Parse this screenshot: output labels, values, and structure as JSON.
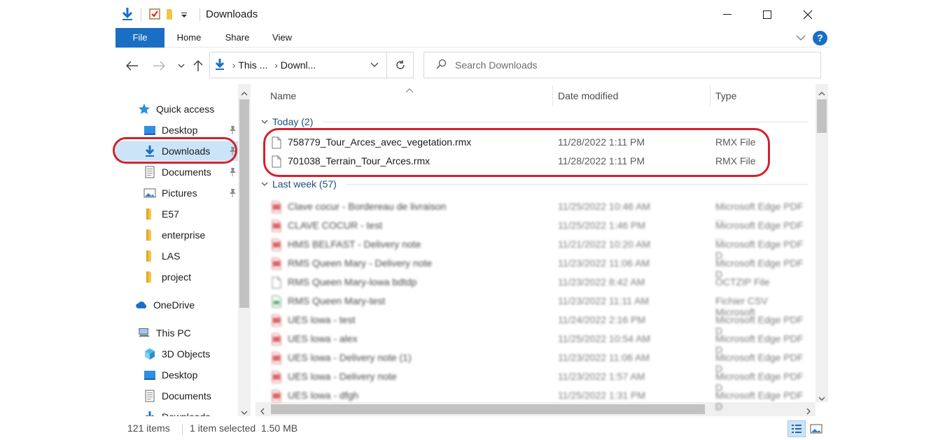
{
  "window": {
    "title": "Downloads"
  },
  "ribbon": {
    "tabs": [
      "File",
      "Home",
      "Share",
      "View"
    ],
    "help": "?"
  },
  "address": {
    "segments": [
      "This ...",
      "Downl..."
    ]
  },
  "search": {
    "placeholder": "Search Downloads"
  },
  "nav": {
    "items": [
      {
        "label": "Quick access",
        "icon": "star-icon",
        "pinned": false
      },
      {
        "label": "Desktop",
        "icon": "desktop-icon",
        "pinned": true
      },
      {
        "label": "Downloads",
        "icon": "download-arrow-icon",
        "pinned": true,
        "selected": true
      },
      {
        "label": "Documents",
        "icon": "documents-icon",
        "pinned": true
      },
      {
        "label": "Pictures",
        "icon": "pictures-icon",
        "pinned": true
      },
      {
        "label": "E57",
        "icon": "folder-icon",
        "pinned": false
      },
      {
        "label": "enterprise",
        "icon": "folder-icon",
        "pinned": false
      },
      {
        "label": "LAS",
        "icon": "folder-icon",
        "pinned": false
      },
      {
        "label": "project",
        "icon": "folder-icon",
        "pinned": false
      },
      {
        "label": "OneDrive",
        "icon": "cloud-icon",
        "pinned": false
      },
      {
        "label": "This PC",
        "icon": "computer-icon",
        "pinned": false
      },
      {
        "label": "3D Objects",
        "icon": "cube-icon",
        "pinned": false
      },
      {
        "label": "Desktop",
        "icon": "desktop-icon",
        "pinned": false
      },
      {
        "label": "Documents",
        "icon": "documents-icon",
        "pinned": false
      },
      {
        "label": "Downloads",
        "icon": "download-arrow-icon",
        "pinned": false
      }
    ]
  },
  "list": {
    "columns": [
      "Name",
      "Date modified",
      "Type"
    ],
    "groups": [
      {
        "label": "Today (2)",
        "rows": [
          {
            "name": "758779_Tour_Arces_avec_vegetation.rmx",
            "date": "11/28/2022 1:11 PM",
            "type": "RMX File"
          },
          {
            "name": "701038_Terrain_Tour_Arces.rmx",
            "date": "11/28/2022 1:11 PM",
            "type": "RMX File"
          }
        ]
      },
      {
        "label": "Last week (57)",
        "rows": [
          {
            "name": "Clave cocur - Bordereau de livraison",
            "date": "11/25/2022 10:46 AM",
            "type": "Microsoft Edge PDF ...",
            "icon": "pdf-icon"
          },
          {
            "name": "CLAVE COCUR - test",
            "date": "11/25/2022 1:46 PM",
            "type": "Microsoft Edge PDF ...",
            "icon": "pdf-icon"
          },
          {
            "name": "HMS BELFAST - Delivery note",
            "date": "11/21/2022 10:20 AM",
            "type": "Microsoft Edge PDF D",
            "icon": "pdf-icon"
          },
          {
            "name": "RMS Queen Mary - Delivery note",
            "date": "11/23/2022 11:06 AM",
            "type": "Microsoft Edge PDF D",
            "icon": "pdf-icon"
          },
          {
            "name": "RMS Queen Mary-lowa bdtdp",
            "date": "11/23/2022 8:42 AM",
            "type": "OCTZIP File",
            "icon": "file-icon"
          },
          {
            "name": "RMS Queen Mary-test",
            "date": "11/23/2022 11:11 AM",
            "type": "Fichier CSV Microsoft",
            "icon": "csv-icon"
          },
          {
            "name": "UES lowa - test",
            "date": "11/24/2022 2:16 PM",
            "type": "Microsoft Edge PDF D",
            "icon": "pdf-icon"
          },
          {
            "name": "UES lowa - alex",
            "date": "11/25/2022 10:54 AM",
            "type": "Microsoft Edge PDF D",
            "icon": "pdf-icon"
          },
          {
            "name": "UES lowa - Delivery note (1)",
            "date": "11/23/2022 11:06 AM",
            "type": "Microsoft Edge PDF D",
            "icon": "pdf-icon"
          },
          {
            "name": "UES lowa - Delivery note",
            "date": "11/23/2022 1:57 AM",
            "type": "Microsoft Edge PDF D",
            "icon": "pdf-icon"
          },
          {
            "name": "UES lowa - dfgh",
            "date": "11/25/2022 1:31 PM",
            "type": "Microsoft Edge PDF D",
            "icon": "pdf-icon"
          }
        ]
      }
    ]
  },
  "status": {
    "count": "121 items",
    "selection": "1 item selected  1.50 MB"
  },
  "colors": {
    "accent": "#1a6fc4",
    "selection": "#cce4f7",
    "annotation": "#d3212d",
    "group": "#1f4e79"
  }
}
